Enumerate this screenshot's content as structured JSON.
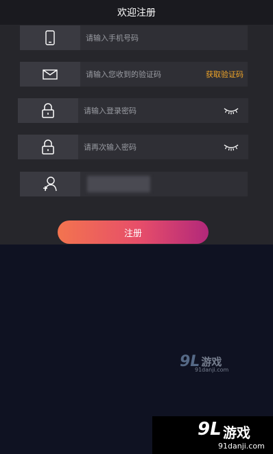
{
  "header": {
    "title": "欢迎注册"
  },
  "form": {
    "phone_placeholder": "请输入手机号码",
    "code_placeholder": "请输入您收到的验证码",
    "get_code_label": "获取验证码",
    "password_placeholder": "请输入登录密码",
    "confirm_password_placeholder": "请再次输入密码",
    "invite_value": ""
  },
  "register": {
    "label": "注册"
  },
  "icons": {
    "phone": "phone-icon",
    "code": "mail-icon",
    "password": "lock-icon",
    "confirm": "lock-icon",
    "invite": "add-user-icon",
    "eye_closed": "eye-closed-icon"
  },
  "colors": {
    "accent": "#f0a528",
    "button_start": "#f3744f",
    "button_end": "#b2287a"
  },
  "watermark": {
    "logo": "9L",
    "text": "游戏",
    "domain": "91danji.com",
    "domain_bottom": "91danji.com"
  }
}
